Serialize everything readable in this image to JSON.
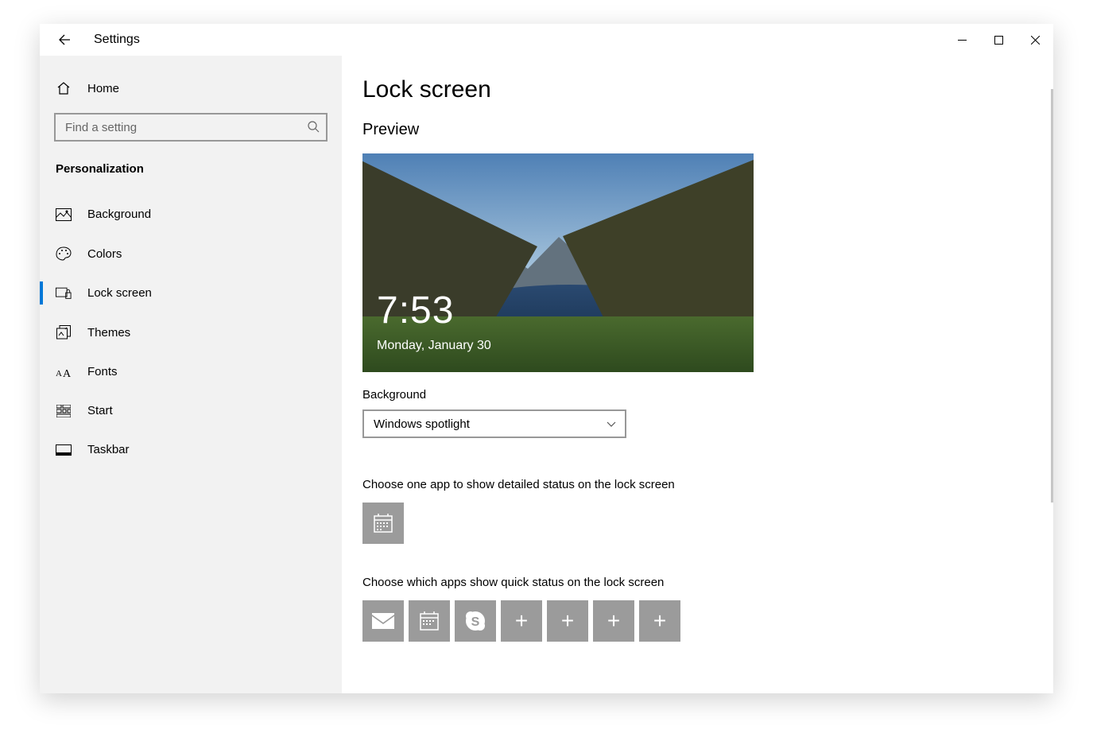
{
  "window": {
    "title": "Settings"
  },
  "sidebar": {
    "home_label": "Home",
    "search_placeholder": "Find a setting",
    "section_label": "Personalization",
    "items": [
      {
        "label": "Background",
        "icon": "picture-icon",
        "selected": false
      },
      {
        "label": "Colors",
        "icon": "palette-icon",
        "selected": false
      },
      {
        "label": "Lock screen",
        "icon": "lock-screen-icon",
        "selected": true
      },
      {
        "label": "Themes",
        "icon": "themes-icon",
        "selected": false
      },
      {
        "label": "Fonts",
        "icon": "fonts-icon",
        "selected": false
      },
      {
        "label": "Start",
        "icon": "start-icon",
        "selected": false
      },
      {
        "label": "Taskbar",
        "icon": "taskbar-icon",
        "selected": false
      }
    ]
  },
  "main": {
    "page_title": "Lock screen",
    "preview_heading": "Preview",
    "preview_time": "7:53",
    "preview_date": "Monday, January 30",
    "background_label": "Background",
    "background_value": "Windows spotlight",
    "detailed_status_label": "Choose one app to show detailed status on the lock screen",
    "detailed_status_app": "calendar",
    "quick_status_label": "Choose which apps show quick status on the lock screen",
    "quick_status_apps": [
      "mail",
      "calendar",
      "skype",
      "add",
      "add",
      "add",
      "add"
    ]
  }
}
